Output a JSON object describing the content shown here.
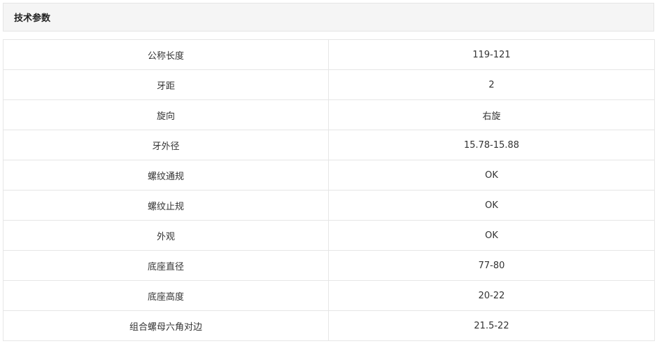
{
  "section": {
    "title": "技术参数"
  },
  "specs": [
    {
      "name": "公称长度",
      "value": "119-121"
    },
    {
      "name": "牙距",
      "value": "2"
    },
    {
      "name": "旋向",
      "value": "右旋"
    },
    {
      "name": "牙外径",
      "value": "15.78-15.88"
    },
    {
      "name": "螺纹通规",
      "value": "OK"
    },
    {
      "name": "螺纹止规",
      "value": "OK"
    },
    {
      "name": "外观",
      "value": "OK"
    },
    {
      "name": "底座直径",
      "value": "77-80"
    },
    {
      "name": "底座高度",
      "value": "20-22"
    },
    {
      "name": "组合螺母六角对边",
      "value": "21.5-22"
    }
  ],
  "colors": {
    "header_background": "#f5f5f5",
    "border": "#e6e6e6",
    "text": "#333333"
  }
}
